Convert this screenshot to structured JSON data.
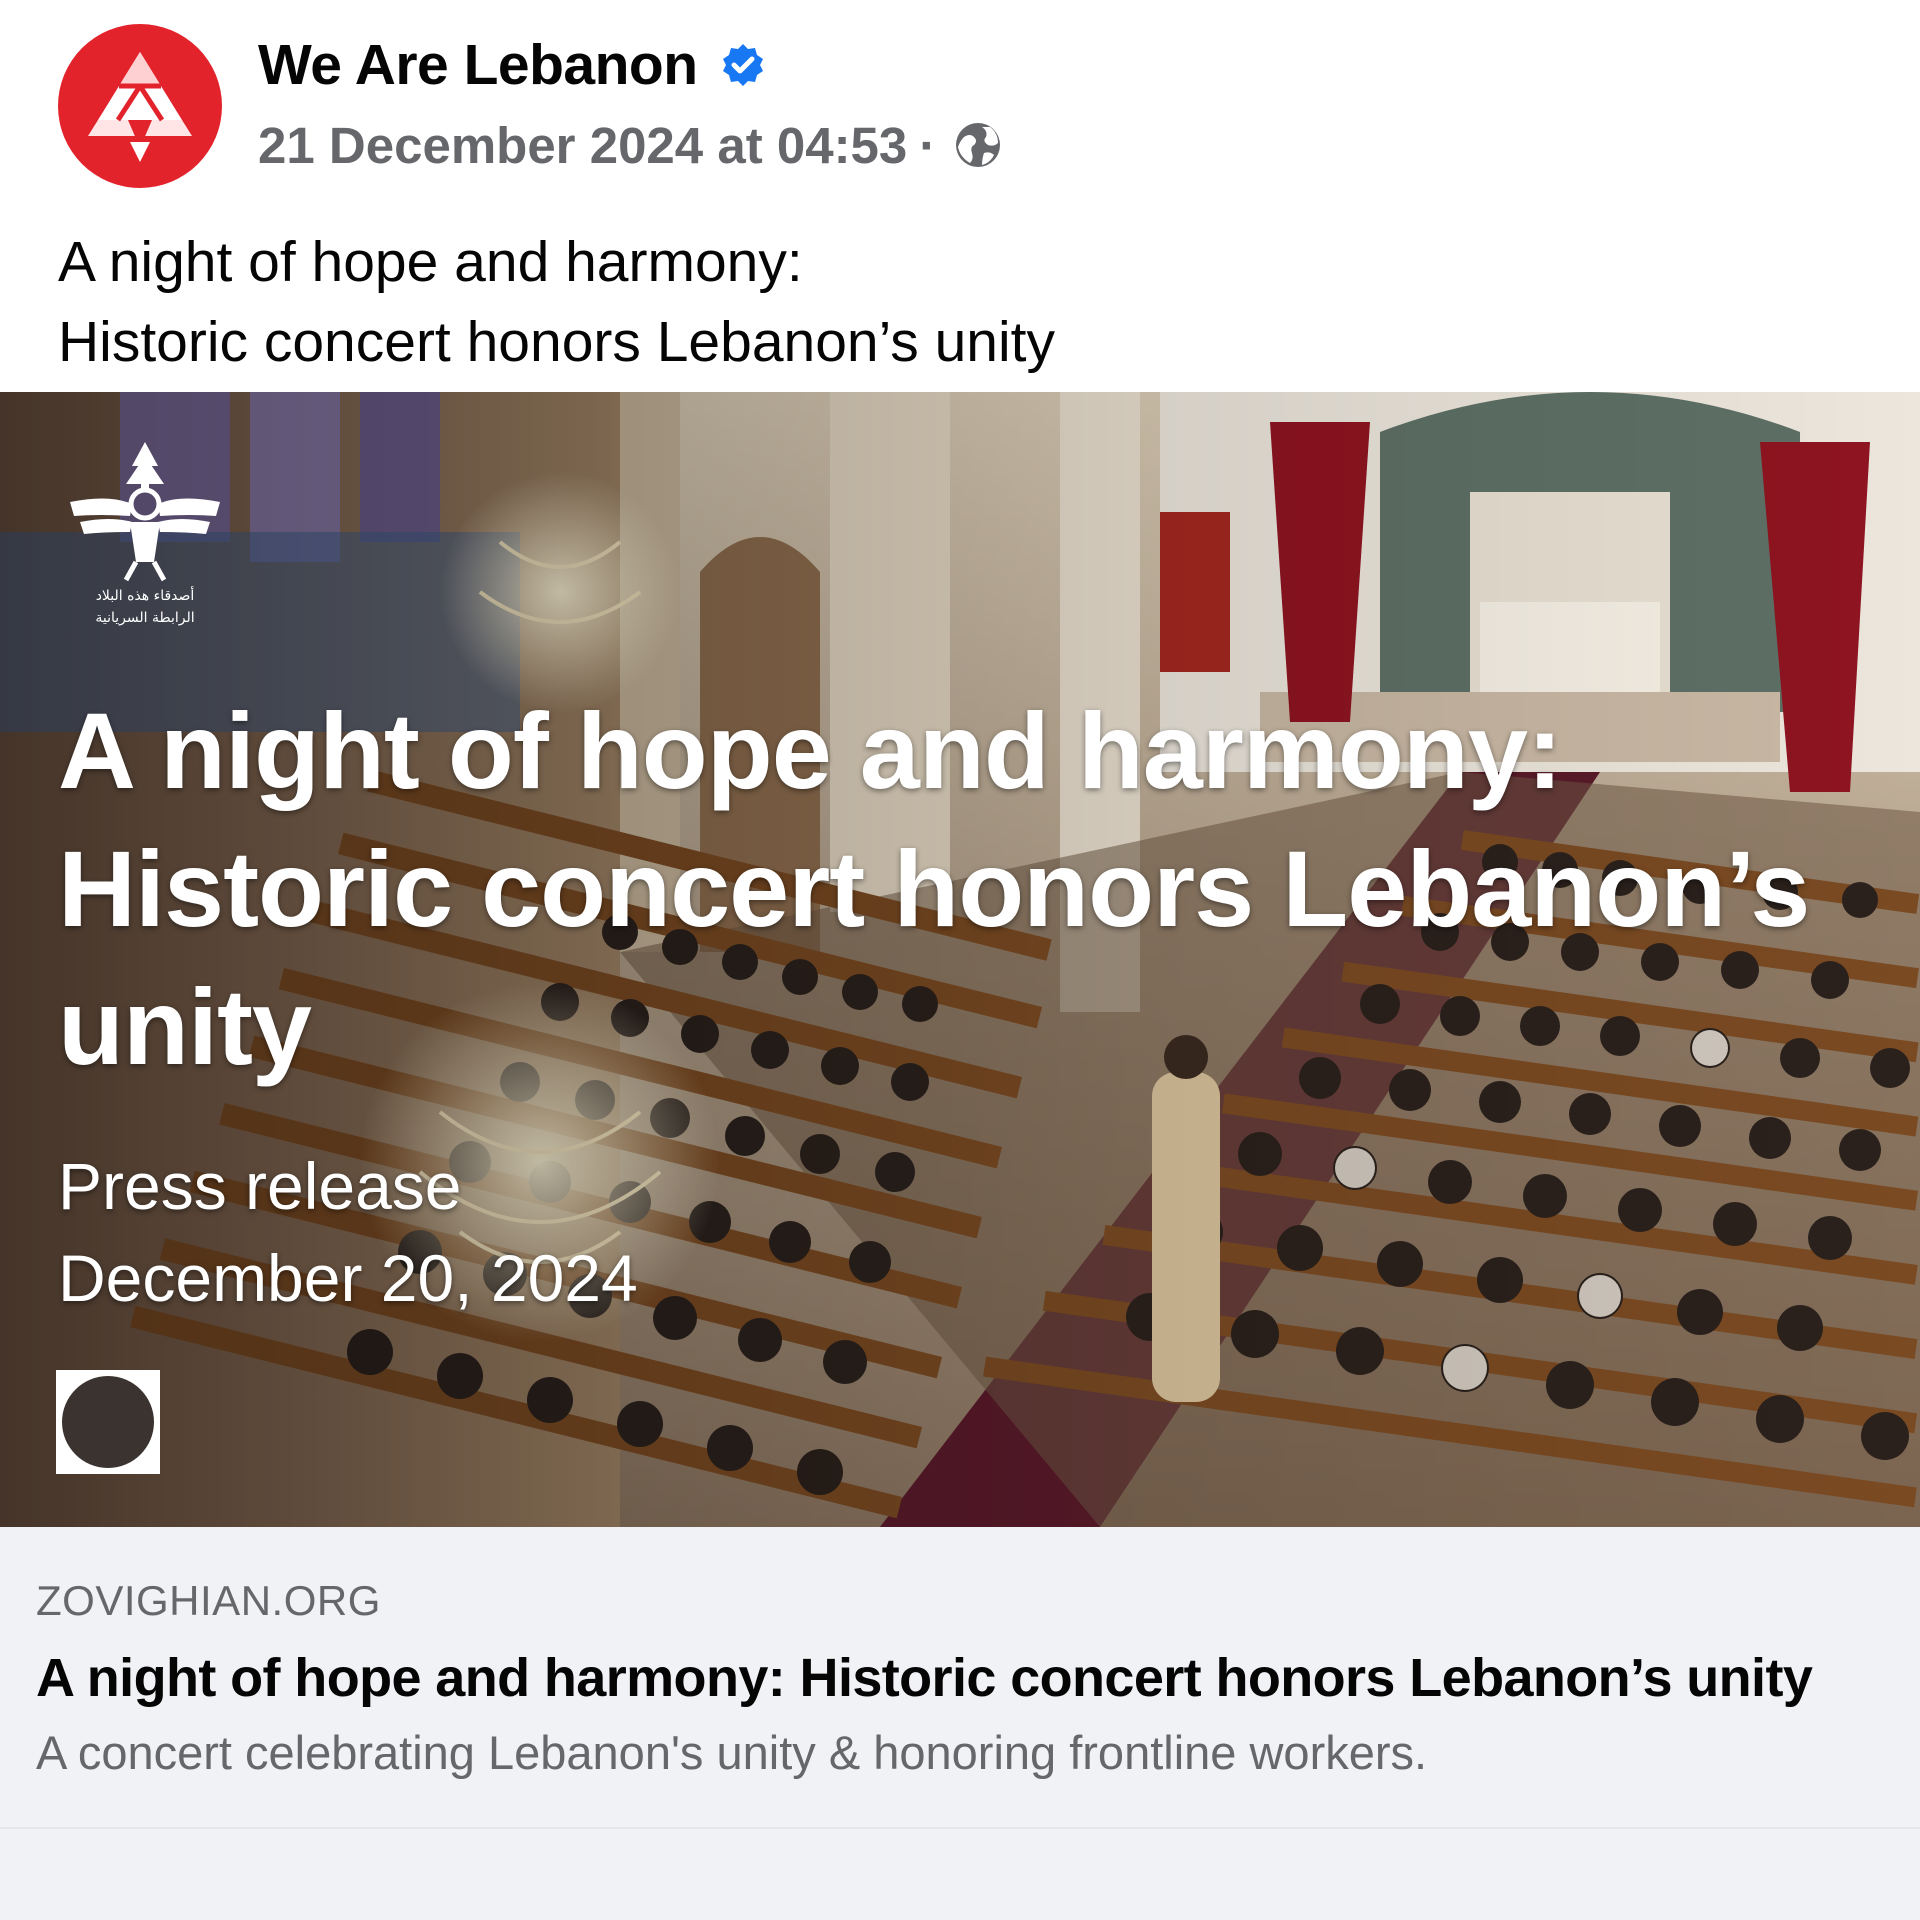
{
  "post": {
    "author_name": "We Are Lebanon",
    "verified_icon": "verified-badge-icon",
    "timestamp": "21 December 2024 at 04:53",
    "separator": "·",
    "audience_icon": "globe-icon",
    "caption_line1": "A night of hope and harmony:",
    "caption_line2": "Historic concert honors Lebanon’s unity"
  },
  "link_preview": {
    "image": {
      "overlay_title_line1": "A night of hope and harmony:",
      "overlay_title_line2": "Historic concert honors Lebanon’s",
      "overlay_title_line3": "unity",
      "overlay_sub_line1": "Press release",
      "overlay_sub_line2": "December 20, 2024",
      "org_logo_text_line1": "أصدقاء هذه البلاد",
      "org_logo_text_line2": "الرابطة السريانية"
    },
    "domain": "ZOVIGHIAN.ORG",
    "title": "A night of hope and harmony: Historic concert honors Lebanon’s unity",
    "description": "A concert celebrating Lebanon's unity & honoring frontline workers."
  },
  "colors": {
    "avatar_red": "#e3232c",
    "verified_blue": "#1877f2",
    "meta_gray": "#65676b",
    "footer_bg": "#f0f2f5"
  }
}
